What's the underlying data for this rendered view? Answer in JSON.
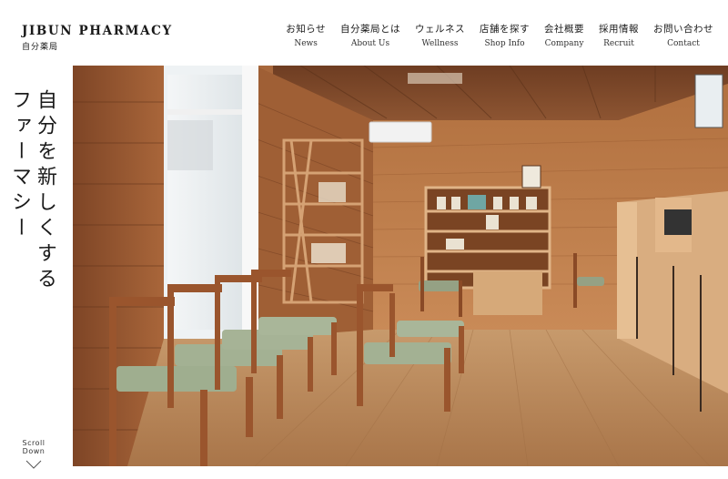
{
  "brand": {
    "name_en": "JIBUN PHARMACY",
    "name_jp": "自分薬局"
  },
  "nav": [
    {
      "jp": "お知らせ",
      "en": "News"
    },
    {
      "jp": "自分薬局とは",
      "en": "About Us"
    },
    {
      "jp": "ウェルネス",
      "en": "Wellness"
    },
    {
      "jp": "店舗を探す",
      "en": "Shop Info"
    },
    {
      "jp": "会社概要",
      "en": "Company"
    },
    {
      "jp": "採用情報",
      "en": "Recruit"
    },
    {
      "jp": "お問い合わせ",
      "en": "Contact"
    }
  ],
  "hero": {
    "tagline_line1": "自分を新しくする",
    "tagline_line2": "ファーマシー"
  },
  "scroll": {
    "label": "Scroll Down"
  },
  "colors": {
    "wood_dark": "#8a4f2a",
    "wood_mid": "#b57648",
    "wood_light": "#d9a878",
    "seat_green": "#9aa88a",
    "text": "#1a1a1a"
  }
}
